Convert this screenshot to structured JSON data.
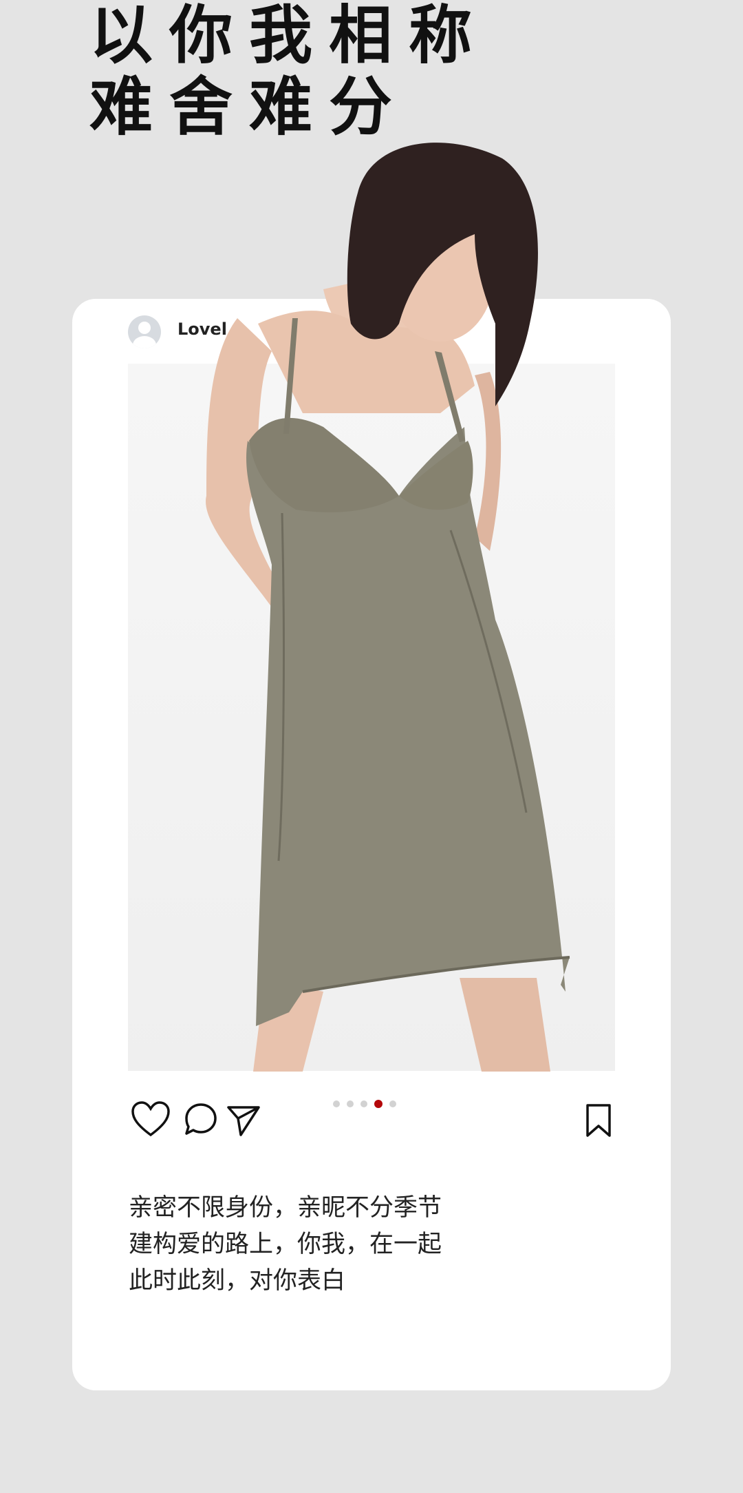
{
  "headline": {
    "line1": "以你我相称",
    "line2": "难舍难分"
  },
  "post": {
    "username": "Lovel",
    "avatar_icon": "user-avatar-icon",
    "carousel": {
      "total": 5,
      "active_index": 3
    },
    "actions": {
      "like_icon": "heart-icon",
      "comment_icon": "comment-icon",
      "share_icon": "send-icon",
      "save_icon": "bookmark-icon"
    },
    "caption": [
      "亲密不限身份，亲昵不分季节",
      "建构爱的路上，你我，在一起",
      "此时此刻，对你表白"
    ]
  },
  "colors": {
    "background": "#e4e4e4",
    "card": "#ffffff",
    "dress": "#8b8878",
    "accent_dot": "#b4080a"
  }
}
